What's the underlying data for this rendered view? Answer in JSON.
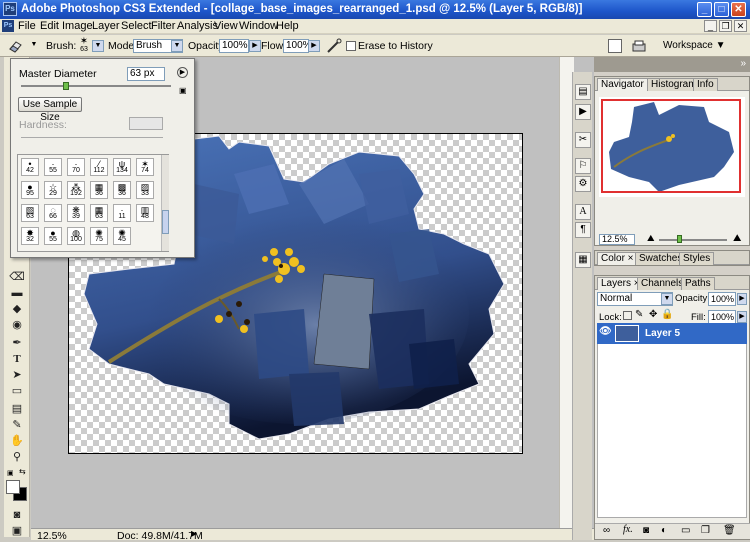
{
  "window": {
    "title": "Adobe Photoshop CS3 Extended - [collage_base_images_rearranged_1.psd @ 12.5% (Layer 5, RGB/8)]",
    "logo": "Ps",
    "min_glyph": "_",
    "max_glyph": "□",
    "close_glyph": "✕"
  },
  "menubar": {
    "items": [
      "File",
      "Edit",
      "Image",
      "Layer",
      "Select",
      "Filter",
      "Analysis",
      "View",
      "Window",
      "Help"
    ],
    "doc_min": "_",
    "doc_restore": "❐",
    "doc_close": "✕"
  },
  "options": {
    "brush_label": "Brush:",
    "brush_size": "63",
    "mode_label": "Mode:",
    "mode_value": "Brush",
    "opacity_label": "Opacity:",
    "opacity_value": "100%",
    "flow_label": "Flow:",
    "flow_value": "100%",
    "erase_history_label": "Erase to History",
    "workspace_label": "Workspace ▼"
  },
  "brush_picker": {
    "master_diameter_label": "Master Diameter",
    "master_diameter_value": "63 px",
    "master_diameter_fraction": 0.3,
    "use_sample_size_label": "Use Sample Size",
    "hardness_label": "Hardness:",
    "presets": [
      {
        "glyph": "•",
        "size": "42"
      },
      {
        "glyph": "·",
        "size": "55"
      },
      {
        "glyph": "·",
        "size": "70"
      },
      {
        "glyph": "⁄",
        "size": "112"
      },
      {
        "glyph": "ψ",
        "size": "134"
      },
      {
        "glyph": "✶",
        "size": "74"
      },
      {
        "glyph": "●",
        "size": "95"
      },
      {
        "glyph": "☆",
        "size": "29"
      },
      {
        "glyph": "⁂",
        "size": "192"
      },
      {
        "glyph": "▦",
        "size": "36"
      },
      {
        "glyph": "▩",
        "size": "36"
      },
      {
        "glyph": "▨",
        "size": "33"
      },
      {
        "glyph": "▧",
        "size": "63"
      },
      {
        "glyph": "◌",
        "size": "66"
      },
      {
        "glyph": "❋",
        "size": "39"
      },
      {
        "glyph": "▦",
        "size": "63"
      },
      {
        "glyph": "·",
        "size": "11"
      },
      {
        "glyph": "▥",
        "size": "48"
      },
      {
        "glyph": "✸",
        "size": "32"
      },
      {
        "glyph": "●",
        "size": "55"
      },
      {
        "glyph": "◍",
        "size": "100"
      },
      {
        "glyph": "✺",
        "size": "75"
      },
      {
        "glyph": "✺",
        "size": "45"
      }
    ]
  },
  "status": {
    "zoom": "12.5%",
    "doc_info": "Doc: 49.8M/41.7M"
  },
  "navigator": {
    "tabs": [
      "Navigator ×",
      "Histogram",
      "Info"
    ],
    "zoom": "12.5%"
  },
  "color_panel": {
    "tabs": [
      "Color ×",
      "Swatches",
      "Styles"
    ]
  },
  "layers_panel": {
    "tabs": [
      "Layers ×",
      "Channels",
      "Paths"
    ],
    "blend_mode": "Normal",
    "opacity_label": "Opacity:",
    "opacity_value": "100%",
    "lock_label": "Lock:",
    "fill_label": "Fill:",
    "fill_value": "100%",
    "layers": [
      {
        "name": "Layer 5",
        "visible": true,
        "selected": true
      }
    ]
  },
  "colors": {
    "accent": "#3169c6",
    "collage_blue": "#3e5f9c",
    "flower_yellow": "#f0c020"
  }
}
